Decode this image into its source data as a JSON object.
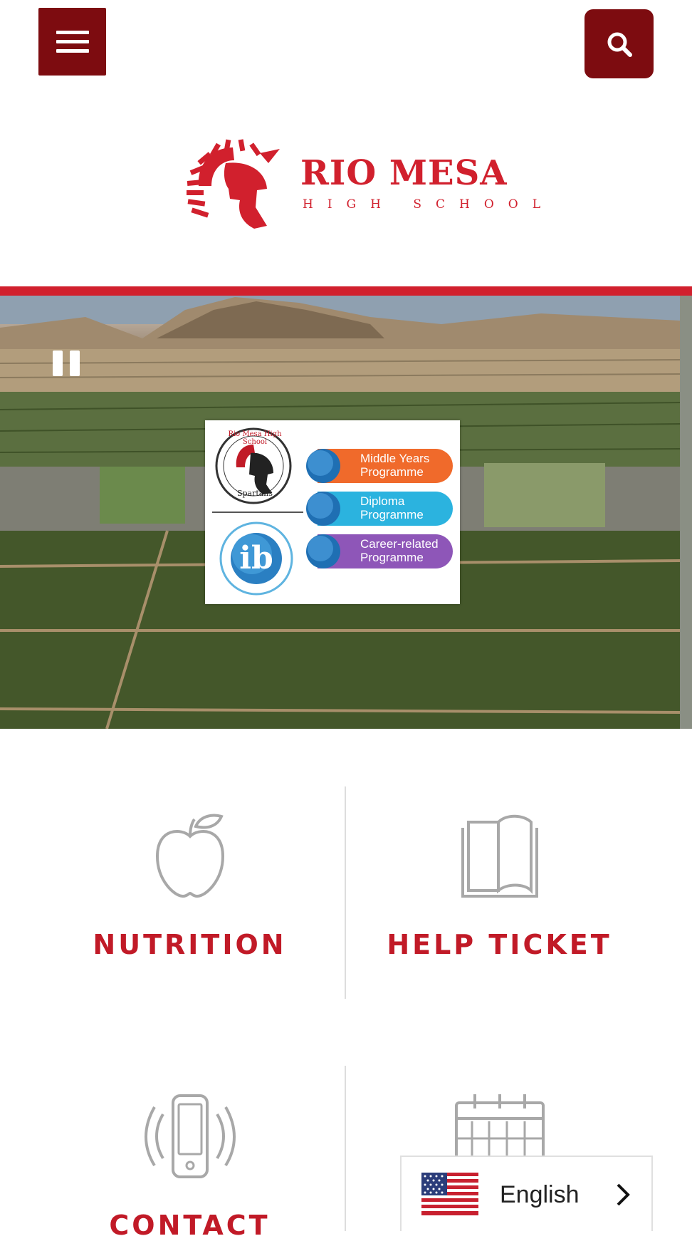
{
  "header": {
    "menu_icon": "hamburger-menu-icon",
    "search_icon": "search-icon"
  },
  "logo": {
    "name": "RIO MESA",
    "subtitle": "HIGH SCHOOL"
  },
  "hero": {
    "badge": {
      "school_seal_text_top": "Rio Mesa High School",
      "school_seal_text_bottom": "Spartans",
      "ib_logo_text": "ib",
      "programmes": [
        {
          "label": "Middle Years Programme",
          "color": "#f06a2b"
        },
        {
          "label": "Diploma Programme",
          "color": "#2bb3df"
        },
        {
          "label": "Career-related Programme",
          "color": "#8e56b8"
        }
      ]
    }
  },
  "quick_links": [
    {
      "label": "NUTRITION",
      "icon": "apple-icon"
    },
    {
      "label": "HELP TICKET",
      "icon": "open-book-icon"
    },
    {
      "label": "CONTACT",
      "icon": "vibrating-phone-icon"
    },
    {
      "label": "",
      "icon": "calendar-icon"
    }
  ],
  "language": {
    "label": "English",
    "flag": "us-flag-icon"
  },
  "colors": {
    "brand_red": "#d1202d",
    "dark_red": "#7d0c10",
    "icon_gray": "#a8a8a8"
  }
}
